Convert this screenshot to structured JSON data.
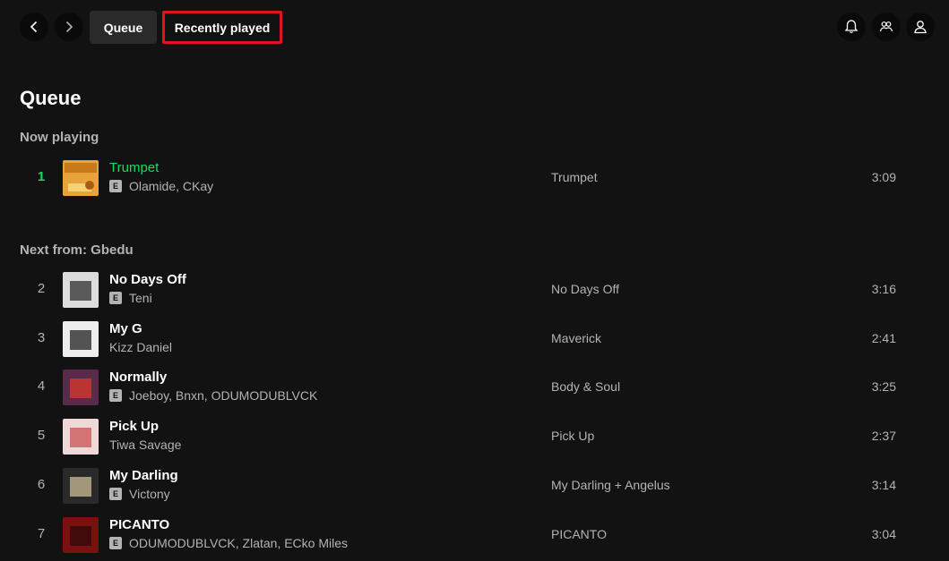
{
  "topbar": {
    "tabs": [
      {
        "label": "Queue"
      },
      {
        "label": "Recently played"
      }
    ]
  },
  "queue": {
    "title": "Queue",
    "now_playing_label": "Now playing",
    "next_label": "Next from: Gbedu",
    "now_playing": {
      "index": "1",
      "title": "Trumpet",
      "explicit": true,
      "explicit_badge": "E",
      "artists": "Olamide, CKay",
      "album": "Trumpet",
      "duration": "3:09"
    },
    "next": [
      {
        "index": "2",
        "title": "No Days Off",
        "explicit": true,
        "explicit_badge": "E",
        "artists": "Teni",
        "album": "No Days Off",
        "duration": "3:16"
      },
      {
        "index": "3",
        "title": "My G",
        "explicit": false,
        "explicit_badge": "",
        "artists": "Kizz Daniel",
        "album": "Maverick",
        "duration": "2:41"
      },
      {
        "index": "4",
        "title": "Normally",
        "explicit": true,
        "explicit_badge": "E",
        "artists": "Joeboy, Bnxn, ODUMODUBLVCK",
        "album": "Body & Soul",
        "duration": "3:25"
      },
      {
        "index": "5",
        "title": "Pick Up",
        "explicit": false,
        "explicit_badge": "",
        "artists": "Tiwa Savage",
        "album": "Pick Up",
        "duration": "2:37"
      },
      {
        "index": "6",
        "title": "My Darling",
        "explicit": true,
        "explicit_badge": "E",
        "artists": "Victony",
        "album": "My Darling + Angelus",
        "duration": "3:14"
      },
      {
        "index": "7",
        "title": "PICANTO",
        "explicit": true,
        "explicit_badge": "E",
        "artists": "ODUMODUBLVCK, Zlatan, ECko Miles",
        "album": "PICANTO",
        "duration": "3:04"
      }
    ]
  },
  "icons": {
    "back": "chevron-left-icon",
    "forward": "chevron-right-icon",
    "notifications": "bell-icon",
    "friends": "friends-icon",
    "profile": "user-icon"
  },
  "colors": {
    "background": "#121212",
    "accent_green": "#1ed760",
    "highlight_red": "#e0141e",
    "muted_text": "#b3b3b3"
  }
}
